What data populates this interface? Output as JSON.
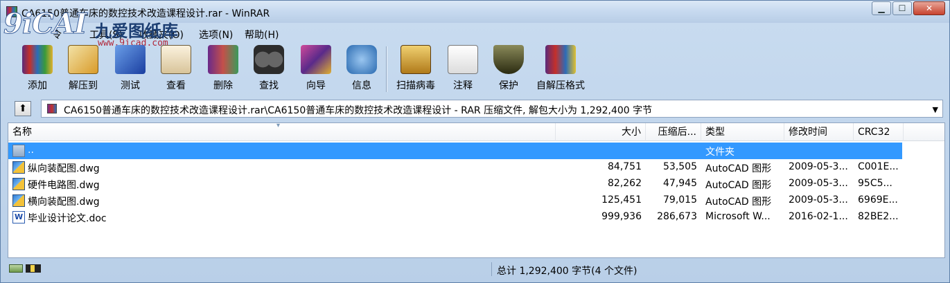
{
  "window": {
    "title": "CA6150普通车床的数控技术改造课程设计.rar - WinRAR",
    "controls": {
      "minimize": "▁",
      "maximize": "☐",
      "close": "✕"
    }
  },
  "watermark": {
    "logo": "9iCAI",
    "chinese": "九爱图纸库",
    "url": "www.9icad.com"
  },
  "menu": {
    "items": [
      {
        "label": "令"
      },
      {
        "label": "工具(S)"
      },
      {
        "label": "收藏夹(O)"
      },
      {
        "label": "选项(N)"
      },
      {
        "label": "帮助(H)"
      }
    ]
  },
  "toolbar": {
    "buttons": [
      {
        "label": "添加",
        "icon": "add-archive-icon",
        "color": "#7a3a9a"
      },
      {
        "label": "解压到",
        "icon": "extract-to-icon",
        "color": "#d99b2a"
      },
      {
        "label": "测试",
        "icon": "test-icon",
        "color": "#2a5ec0"
      },
      {
        "label": "查看",
        "icon": "view-icon",
        "color": "#e8d4a8"
      },
      {
        "label": "删除",
        "icon": "delete-icon",
        "color": "#8a4a9a"
      },
      {
        "label": "查找",
        "icon": "find-icon",
        "color": "#2c2c2c"
      },
      {
        "label": "向导",
        "icon": "wizard-icon",
        "color": "#b02a8a"
      },
      {
        "label": "信息",
        "icon": "info-icon",
        "color": "#2a6ab0"
      },
      {
        "label": "扫描病毒",
        "icon": "virus-scan-icon",
        "color": "#c89a2a"
      },
      {
        "label": "注释",
        "icon": "comment-icon",
        "color": "#e8e8e8"
      },
      {
        "label": "保护",
        "icon": "protect-icon",
        "color": "#4a4a2a"
      },
      {
        "label": "自解压格式",
        "icon": "sfx-icon",
        "color": "#c8a020"
      }
    ]
  },
  "pathbar": {
    "path": "CA6150普通车床的数控技术改造课程设计.rar\\CA6150普通车床的数控技术改造课程设计 - RAR 压缩文件, 解包大小为 1,292,400 字节"
  },
  "list": {
    "columns": {
      "name": "名称",
      "size": "大小",
      "packed": "压缩后...",
      "type": "类型",
      "modified": "修改时间",
      "crc": "CRC32"
    },
    "rows": [
      {
        "name": "..",
        "size": "",
        "packed": "",
        "type": "文件夹",
        "modified": "",
        "crc": "",
        "icon": "folder-up-icon",
        "selected": true
      },
      {
        "name": "纵向装配图.dwg",
        "size": "84,751",
        "packed": "53,505",
        "type": "AutoCAD 图形",
        "modified": "2009-05-3...",
        "crc": "C001E...",
        "icon": "dwg-file-icon",
        "selected": false
      },
      {
        "name": "硬件电路图.dwg",
        "size": "82,262",
        "packed": "47,945",
        "type": "AutoCAD 图形",
        "modified": "2009-05-3...",
        "crc": "95C5...",
        "icon": "dwg-file-icon",
        "selected": false
      },
      {
        "name": "横向装配图.dwg",
        "size": "125,451",
        "packed": "79,015",
        "type": "AutoCAD 图形",
        "modified": "2009-05-3...",
        "crc": "6969E...",
        "icon": "dwg-file-icon",
        "selected": false
      },
      {
        "name": "毕业设计论文.doc",
        "size": "999,936",
        "packed": "286,673",
        "type": "Microsoft W...",
        "modified": "2016-02-1...",
        "crc": "82BE2...",
        "icon": "word-doc-icon",
        "selected": false
      }
    ]
  },
  "status": {
    "total": "总计 1,292,400 字节(4 个文件)"
  },
  "colors": {
    "selection": "#3399ff",
    "window_frame": "#b9cfe8"
  }
}
